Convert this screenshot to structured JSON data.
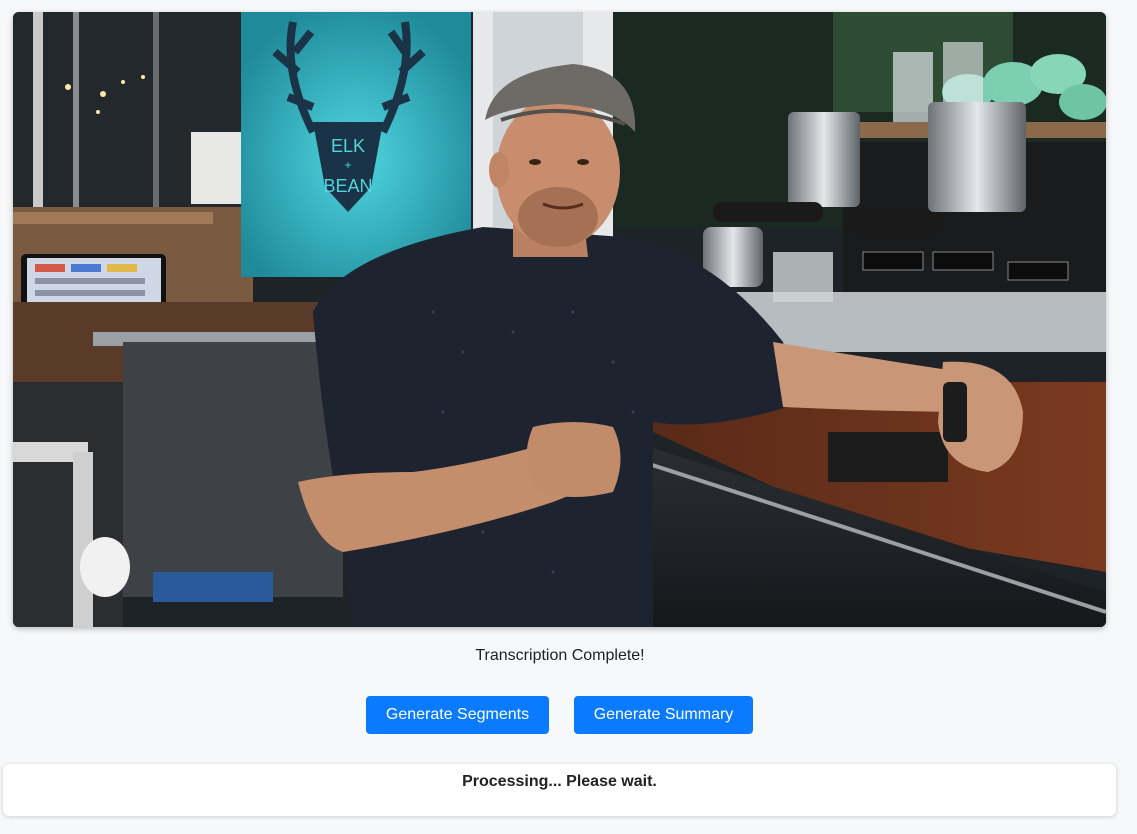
{
  "video": {
    "sign_text_line1": "ELK",
    "sign_text_line2": "+",
    "sign_text_line3": "BEAN"
  },
  "status": {
    "message": "Transcription Complete!"
  },
  "actions": {
    "generate_segments_label": "Generate Segments",
    "generate_summary_label": "Generate Summary"
  },
  "processing": {
    "message": "Processing... Please wait."
  },
  "colors": {
    "accent": "#0a7bff",
    "background": "#f7f8fa",
    "card": "#ffffff"
  }
}
